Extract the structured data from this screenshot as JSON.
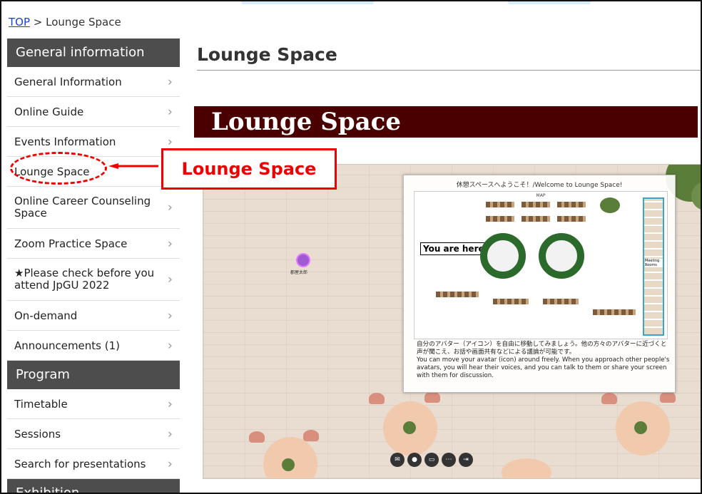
{
  "breadcrumb": {
    "top_link": "TOP",
    "separator": ">",
    "current": "Lounge Space"
  },
  "sidebar": {
    "sections": [
      {
        "heading": "General information",
        "items": [
          {
            "label": "General Information"
          },
          {
            "label": "Online Guide"
          },
          {
            "label": "Events Information"
          },
          {
            "label": "Lounge Space"
          },
          {
            "label": "Online Career Counseling Space"
          },
          {
            "label": "Zoom Practice Space"
          },
          {
            "label": "★Please check before you attend JpGU 2022"
          },
          {
            "label": "On-demand"
          },
          {
            "label": "Announcements (1)"
          }
        ]
      },
      {
        "heading": "Program",
        "items": [
          {
            "label": "Timetable"
          },
          {
            "label": "Sessions"
          },
          {
            "label": "Search for presentations"
          }
        ]
      },
      {
        "heading": "Exhibition",
        "items": []
      }
    ]
  },
  "main": {
    "page_title": "Lounge Space",
    "banner_title": "Lounge Space"
  },
  "callout": {
    "label": "Lounge Space"
  },
  "lounge": {
    "overlay_title": "休憩スペースへようこそ！/Welcome to Lounge Space!",
    "map_label": "MAP",
    "you_are_here": "You are here.",
    "meeting_rooms_label": "Meeting Rooms",
    "description_ja": "自分のアバター（アイコン）を自由に移動してみましょう。他の方々のアバターに近づくと声が聞こえ、お話や画面共有などによる議論が可能です。",
    "description_en": "You can move your avatar (icon) around freely. When you approach other people's avatars, you will hear their voices, and you can talk to them or share your screen with them for discussion.",
    "avatar_name": "郡屋太郎",
    "controls": [
      "chat",
      "mic",
      "screen",
      "more",
      "leave"
    ]
  },
  "colors": {
    "sidebar_heading_bg": "#4d4d4d",
    "banner_bg": "#4b0000",
    "highlight": "#ee0000",
    "link": "#1a44c8"
  }
}
